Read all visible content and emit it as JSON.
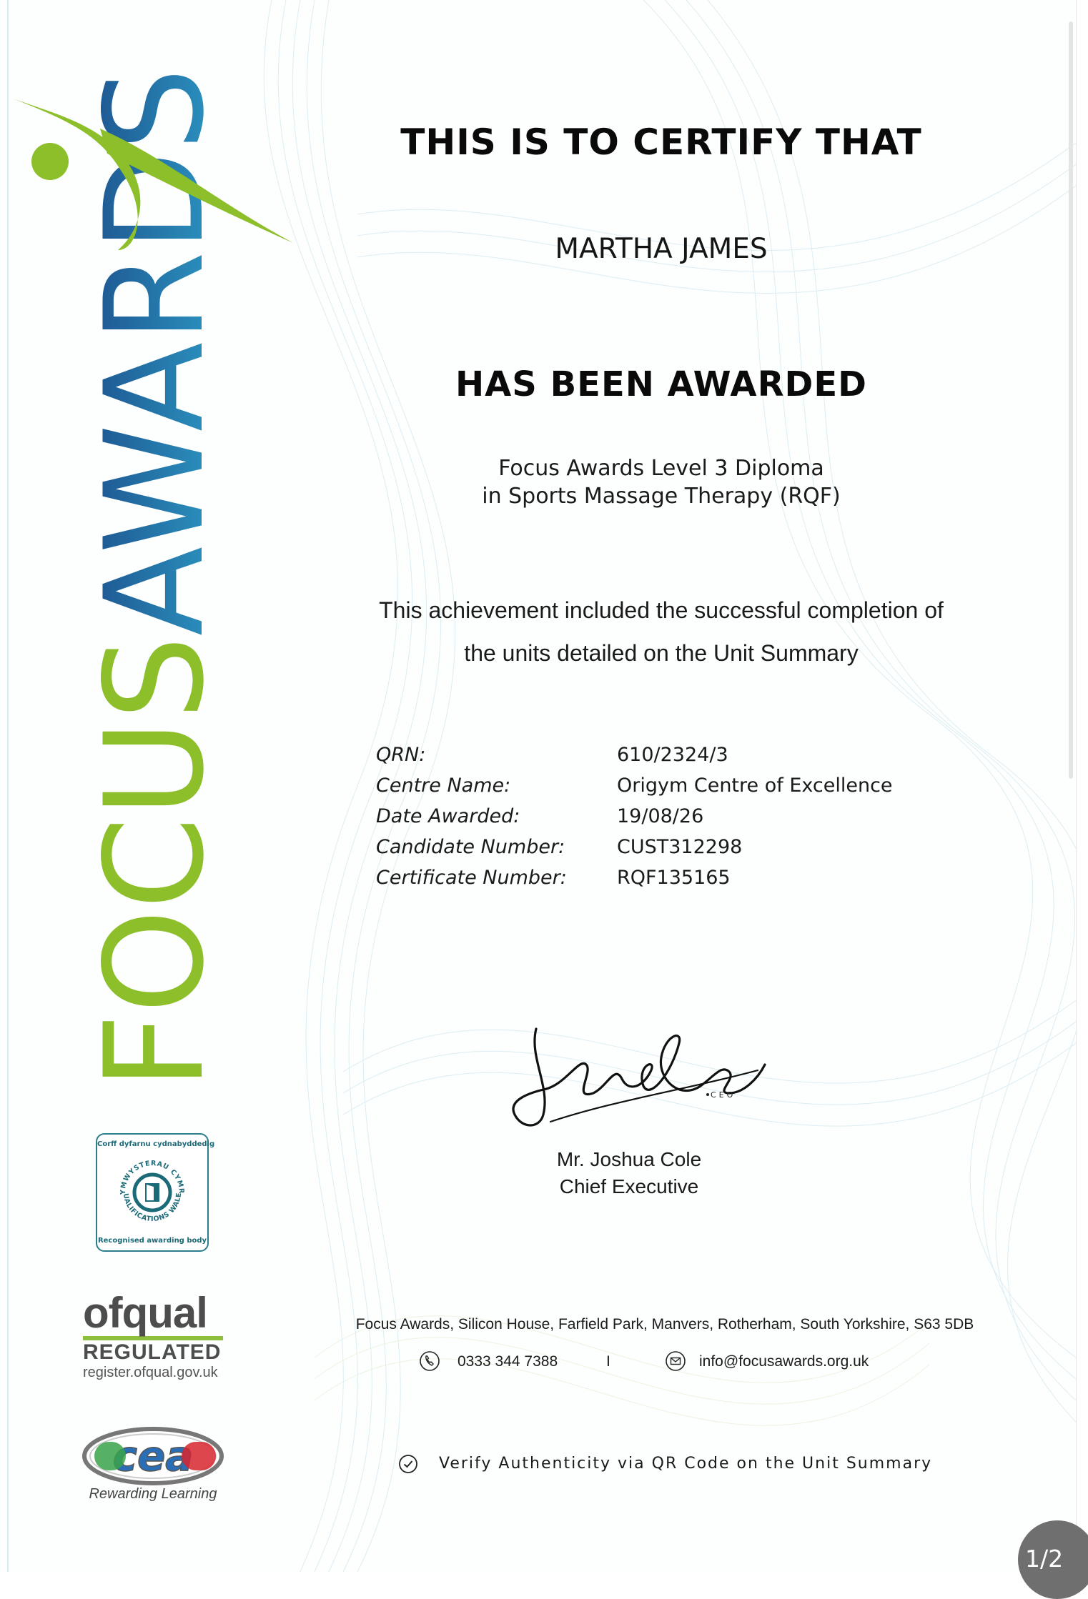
{
  "brand": {
    "word_focus": "FOCUS",
    "word_awards": "AWARDS",
    "color_green": "#8cbf2a",
    "color_blue": "#1f5f9e",
    "color_teal": "#2d9cc6"
  },
  "certificate": {
    "heading_certify": "THIS IS TO CERTIFY THAT",
    "recipient": "MARTHA JAMES",
    "heading_awarded": "HAS BEEN AWARDED",
    "qualification_line1": "Focus Awards Level 3 Diploma",
    "qualification_line2": "in Sports Massage Therapy (RQF)",
    "achievement_line1": "This achievement included the successful completion of",
    "achievement_line2": "the units detailed on the Unit Summary"
  },
  "details": [
    {
      "label": "QRN:",
      "value": "610/2324/3"
    },
    {
      "label": "Centre Name:",
      "value": "Origym Centre of Excellence"
    },
    {
      "label": "Date Awarded:",
      "value": "19/08/26"
    },
    {
      "label": "Candidate Number:",
      "value": "CUST312298"
    },
    {
      "label": "Certificate Number:",
      "value": "RQF135165"
    }
  ],
  "signature": {
    "script": "Joshua Cole",
    "suffix": "CEO",
    "name": "Mr. Joshua Cole",
    "title": "Chief Executive"
  },
  "footer": {
    "address": "Focus Awards, Silicon House, Farfield Park, Manvers, Rotherham, South Yorkshire, S63 5DB",
    "phone": "0333 344 7388",
    "separator": "I",
    "email": "info@focusawards.org.uk",
    "verify": "Verify Authenticity via QR Code on the Unit Summary"
  },
  "logos": {
    "qw_top": "Corff dyfarnu cydnabyddedig",
    "qw_ring_top": "CYMWYSTERAU CYMRU",
    "qw_ring_bottom": "QUALIFICATIONS WALES",
    "qw_bottom": "Recognised awarding body",
    "ofqual_word": "ofqual",
    "ofqual_regulated": "REGULATED",
    "ofqual_site": "register.ofqual.gov.uk",
    "cea_word": "cea",
    "cea_tag": "Rewarding Learning"
  },
  "pager": {
    "label": "1/2"
  }
}
